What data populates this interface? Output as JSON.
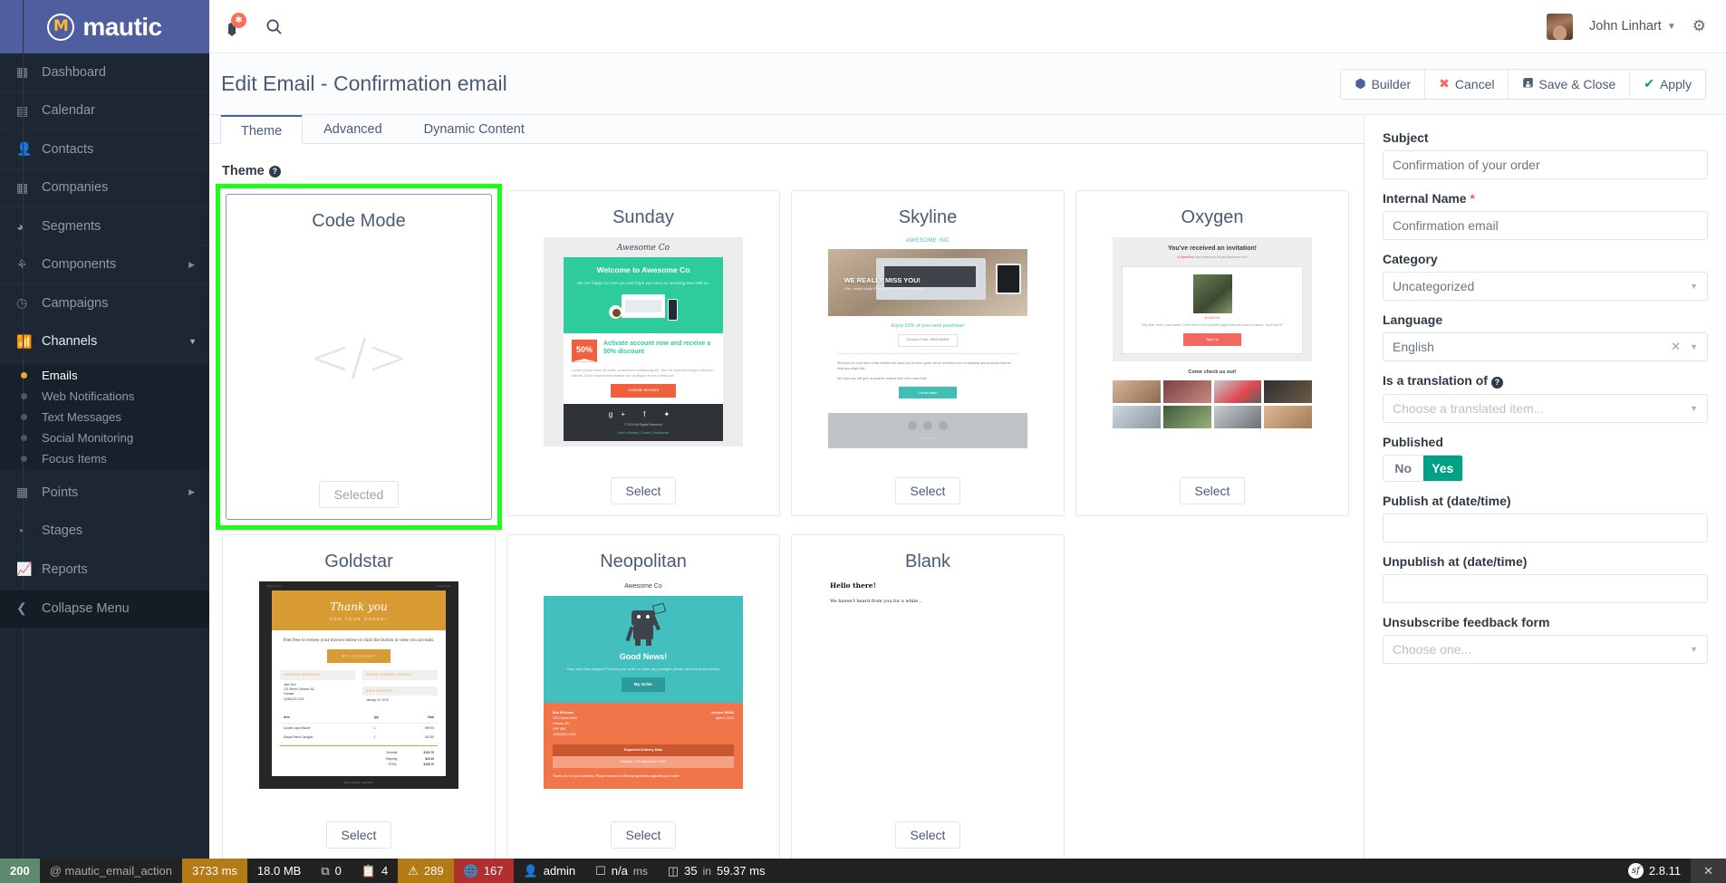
{
  "brand": {
    "name": "mautic",
    "logo_glyph": "M"
  },
  "sidebar": {
    "items": [
      {
        "label": "Dashboard",
        "icon": "dashboard-icon",
        "glyph": "▦"
      },
      {
        "label": "Calendar",
        "icon": "calendar-icon",
        "glyph": "▤"
      },
      {
        "label": "Contacts",
        "icon": "contacts-icon",
        "glyph": "👤"
      },
      {
        "label": "Companies",
        "icon": "companies-icon",
        "glyph": "🏢"
      },
      {
        "label": "Segments",
        "icon": "segments-icon",
        "glyph": "◕"
      },
      {
        "label": "Components",
        "icon": "components-icon",
        "glyph": "⛬",
        "has_submenu": true
      },
      {
        "label": "Campaigns",
        "icon": "campaigns-icon",
        "glyph": "◷"
      },
      {
        "label": "Channels",
        "icon": "channels-icon",
        "glyph": "📶",
        "expanded": true
      },
      {
        "label": "Points",
        "icon": "points-icon",
        "glyph": "▦",
        "has_submenu": true
      },
      {
        "label": "Stages",
        "icon": "stages-icon",
        "glyph": "◔"
      },
      {
        "label": "Reports",
        "icon": "reports-icon",
        "glyph": "📈"
      }
    ],
    "channels_submenu": [
      {
        "label": "Emails",
        "selected": true
      },
      {
        "label": "Web Notifications",
        "selected": false
      },
      {
        "label": "Text Messages",
        "selected": false
      },
      {
        "label": "Social Monitoring",
        "selected": false
      },
      {
        "label": "Focus Items",
        "selected": false
      }
    ],
    "collapse_label": "Collapse Menu"
  },
  "topbar": {
    "notification_count": "",
    "search_icon": "search-icon",
    "user_name": "John Linhart",
    "settings_icon": "gear-icon"
  },
  "header": {
    "title": "Edit Email - Confirmation email",
    "actions": [
      {
        "label": "Builder",
        "icon": "cube-icon",
        "glyph": "⬡",
        "color": "#4e5e9e"
      },
      {
        "label": "Cancel",
        "icon": "close-icon",
        "glyph": "✖",
        "color": "#f2675f"
      },
      {
        "label": "Save & Close",
        "icon": "save-icon",
        "glyph": "🖫",
        "color": "#4a5b75"
      },
      {
        "label": "Apply",
        "icon": "check-icon",
        "glyph": "✔",
        "color": "#00a185"
      }
    ]
  },
  "tabs": [
    {
      "label": "Theme",
      "active": true
    },
    {
      "label": "Advanced",
      "active": false
    },
    {
      "label": "Dynamic Content",
      "active": false
    }
  ],
  "theme_section": {
    "label": "Theme",
    "help_icon": "help-icon",
    "themes": [
      {
        "name": "Code Mode",
        "button": "Selected",
        "selected": true,
        "highlighted": true,
        "thumb": "code"
      },
      {
        "name": "Sunday",
        "button": "Select",
        "selected": false,
        "highlighted": false,
        "thumb": "sunday"
      },
      {
        "name": "Skyline",
        "button": "Select",
        "selected": false,
        "highlighted": false,
        "thumb": "skyline"
      },
      {
        "name": "Oxygen",
        "button": "Select",
        "selected": false,
        "highlighted": false,
        "thumb": "oxygen"
      },
      {
        "name": "Goldstar",
        "button": "Select",
        "selected": false,
        "highlighted": false,
        "thumb": "goldstar"
      },
      {
        "name": "Neopolitan",
        "button": "Select",
        "selected": false,
        "highlighted": false,
        "thumb": "neopolitan"
      },
      {
        "name": "Blank",
        "button": "Select",
        "selected": false,
        "highlighted": false,
        "thumb": "blank"
      }
    ]
  },
  "thumbnails": {
    "sunday": {
      "brand": "Awesome Co",
      "hero_title": "Welcome to Awesome Co",
      "hero_text": "We are happy to meet you and hope you have an amazing time with us.",
      "badge": "50%",
      "offer": "Activate account now and receive a 50% discount",
      "lorem": "Lorem ipsum dolor sit amet, consectetur adipiscing elit. Sed do eiusmod tempor ullamco laboris. Quis nostrud exercitation nisi ut aliquip ex ea commodo!",
      "cta": "Activate account",
      "social": "g+  f  ✦",
      "copyright": "© 2014 All Rights Reserved",
      "links": "View in Browser | Contact | Unsubscribe"
    },
    "skyline": {
      "logo": "AWESOME INC",
      "hero_title": "WE REALLY MISS YOU!",
      "hero_sub": "Like.. really really. Please give us another chance.",
      "offer": "Enjoy 50% of your next purchase!",
      "coupon": "Coupon Code: 4562189498",
      "p1": "We know it's only been a few months but since you've been gone, we've received a ton of amazing new products that we think you might like.",
      "p2": "We hope you will give us another chance and come have look.",
      "cta": "Come back!",
      "footer": "© Awesome Inc"
    },
    "oxygen": {
      "title": "You've received an invitation!",
      "sub_pre": "@JaneDoe",
      "sub_post": " has invited you to join Awesome Inc!",
      "username": "@JaneDoe",
      "quote": "\"Hey Bob, here's your invite! Come check out my profile page when you have a chance. You'll love it!\"",
      "cta": "Sign Up",
      "come": "Come check us out!"
    },
    "goldstar": {
      "webversion": "Web Version",
      "unsubscribe": "Unsubscribe",
      "title": "Thank you",
      "subtitle": "FOR YOUR ORDER!",
      "intro": "Feel free to review your invoice below or click the button to view you account.",
      "cta": "MY ACCOUNT",
      "shipping_label": "SHIPPING ADDRESS:",
      "shipping_value": "Jane Doe\n123 Street | Victoria, BC\nCanada\n1(250)222-2232",
      "order_label": "ORDER NUMBER: A00CD9",
      "date_label": "DATE SHIPPED:",
      "date_value": "January 12, 2019",
      "table_head": [
        "Item",
        "Qty",
        "Total"
      ],
      "rows": [
        [
          "Double Layed Blazer",
          "1",
          "$99.90"
        ],
        [
          "Draped Neck Cardigan",
          "1",
          "$22.80"
        ]
      ],
      "totals": [
        [
          "Subtotal:",
          "$122.70"
        ],
        [
          "Shipping:",
          "$23.00"
        ],
        [
          "TOTAL:",
          "$145.70"
        ]
      ],
      "footer": "Best regards, Jane Doe"
    },
    "neopolitan": {
      "brand": "Awesome Co",
      "title": "Good News!",
      "sub": "Your order has shipped! To track your order or make any changes please click the button below.",
      "cta": "My Order",
      "name": "Bob Erlicious",
      "addr": "123 Flower Drive\nVictoria, BC\nV9P 2E8\n1(250)222-2232",
      "invoice": "Invoice: 00234",
      "date": "April 3, 2014",
      "delivery_head": "Expected Delivery Date",
      "delivery_date": "Monday, 17th November 2014",
      "thanks": "Thank you for your business. Please contact us with any questions regarding your order."
    },
    "blank": {
      "heading": "Hello there!",
      "text": "We haven't heard from you for a while..."
    }
  },
  "right_panel": {
    "subject": {
      "label": "Subject",
      "value": "Confirmation of your order"
    },
    "internal_name": {
      "label": "Internal Name",
      "required": "*",
      "value": "Confirmation email"
    },
    "category": {
      "label": "Category",
      "value": "Uncategorized"
    },
    "language": {
      "label": "Language",
      "value": "English",
      "clear_icon": "clear-icon"
    },
    "translation": {
      "label": "Is a translation of",
      "help_icon": "help-icon",
      "placeholder": "Choose a translated item..."
    },
    "published": {
      "label": "Published",
      "no": "No",
      "yes": "Yes",
      "active": "Yes"
    },
    "publish_at": {
      "label": "Publish at (date/time)",
      "value": ""
    },
    "unpublish_at": {
      "label": "Unpublish at (date/time)",
      "value": ""
    },
    "unsubscribe_form": {
      "label": "Unsubscribe feedback form",
      "placeholder": "Choose one..."
    }
  },
  "profiler": {
    "status": "200",
    "route": "@ mautic_email_action",
    "time": "3733 ms",
    "memory": "18.0 MB",
    "memory_unit": "MB",
    "forms_icon": "forms-icon",
    "forms": "0",
    "clipboard_icon": "clipboard-icon",
    "clipboard": "4",
    "exception_icon": "exception-icon",
    "exceptions": "289",
    "translation_icon": "translation-icon",
    "translations": "167",
    "user_icon": "user-icon",
    "user": "admin",
    "render_icon": "render-icon",
    "render": "n/a",
    "render_unit": "ms",
    "db_icon": "database-icon",
    "db_queries": "35",
    "db_in": "in",
    "db_time": "59.37 ms",
    "sf_logo": "sf",
    "version": "2.8.11",
    "close_icon": "close-icon"
  }
}
